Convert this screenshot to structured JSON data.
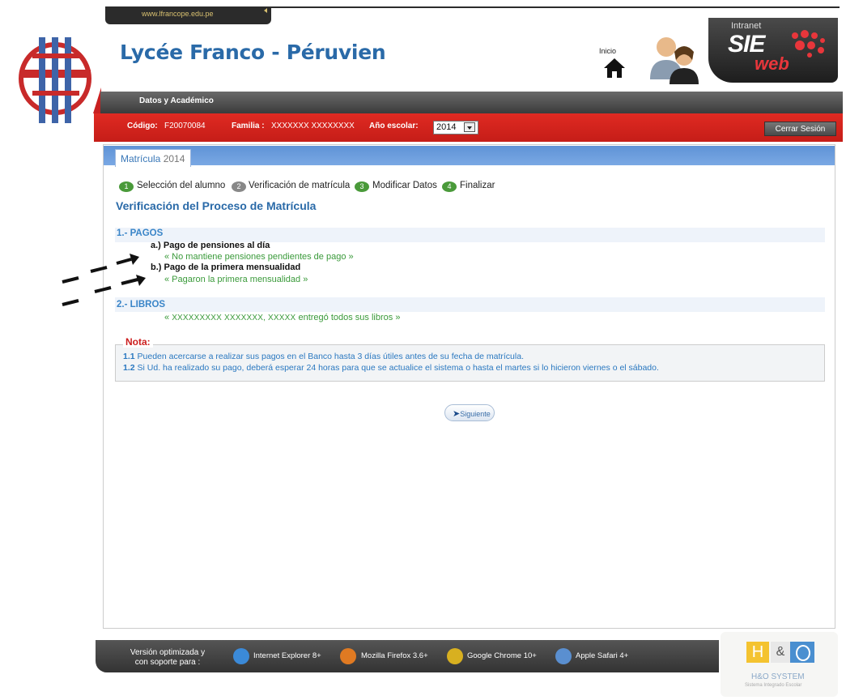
{
  "browser": {
    "url": "www.lfrancope.edu.pe"
  },
  "header": {
    "school_name": "Lycée Franco - Péruvien",
    "home_label": "Inicio",
    "sie": {
      "intranet": "Intranet",
      "sie": "SIE",
      "web": "web"
    }
  },
  "nav": {
    "section_label": "Datos y Académico"
  },
  "info_bar": {
    "code_label": "Código:",
    "code_value": "F20070084",
    "family_label": "Familia :",
    "family_value": "XXXXXXX XXXXXXXX",
    "year_label": "Año escolar:",
    "year_value": "2014",
    "logout_label": "Cerrar Sesión"
  },
  "tab": {
    "label": "Matrícula",
    "year": "2014"
  },
  "steps": [
    {
      "number": "1",
      "label": "Selección del alumno",
      "color": "#4a9a3a"
    },
    {
      "number": "2",
      "label": "Verificación de matrícula",
      "color": "#888888"
    },
    {
      "number": "3",
      "label": "Modificar Datos",
      "color": "#4a9a3a"
    },
    {
      "number": "4",
      "label": "Finalizar",
      "color": "#4a9a3a"
    }
  ],
  "page_heading": "Verificación del Proceso de Matrícula",
  "sections": {
    "pagos": {
      "title": "1.- PAGOS",
      "items": [
        {
          "label": "a.) Pago de pensiones al día",
          "status": "« No mantiene pensiones pendientes de pago »"
        },
        {
          "label": "b.) Pago de la primera mensualidad",
          "status": "« Pagaron la primera mensualidad »"
        }
      ]
    },
    "libros": {
      "title": "2.- LIBROS",
      "open": "«",
      "names": "XXXXXXXXX XXXXXXX, XXXXX",
      "status": "entregó todos sus libros »"
    }
  },
  "note": {
    "title": "Nota:",
    "lines": [
      {
        "num": "1.1",
        "text": "Pueden acercarse a realizar sus pagos en el Banco hasta 3 días útiles antes de su fecha de matrícula."
      },
      {
        "num": "1.2",
        "text": "Si Ud. ha realizado su pago, deberá esperar 24 horas para que se actualice el sistema o hasta el martes si lo hicieron viernes o el sábado."
      }
    ]
  },
  "next_button": "Siguiente",
  "footer": {
    "line1": "Versión optimizada y",
    "line2": "con soporte para :",
    "browsers": [
      {
        "label": "Internet Explorer 8+",
        "icon": "ie-icon",
        "color": "#3b8ad8"
      },
      {
        "label": "Mozilla Firefox 3.6+",
        "icon": "firefox-icon",
        "color": "#e07a22"
      },
      {
        "label": "Google Chrome 10+",
        "icon": "chrome-icon",
        "color": "#d8b020"
      },
      {
        "label": "Apple Safari 4+",
        "icon": "safari-icon",
        "color": "#5a8fd0"
      }
    ]
  },
  "vendor": {
    "h": "H",
    "amp": "&",
    "name": "H&O SYSTEM",
    "subtitle": "Sistema Integrado Escolar"
  }
}
